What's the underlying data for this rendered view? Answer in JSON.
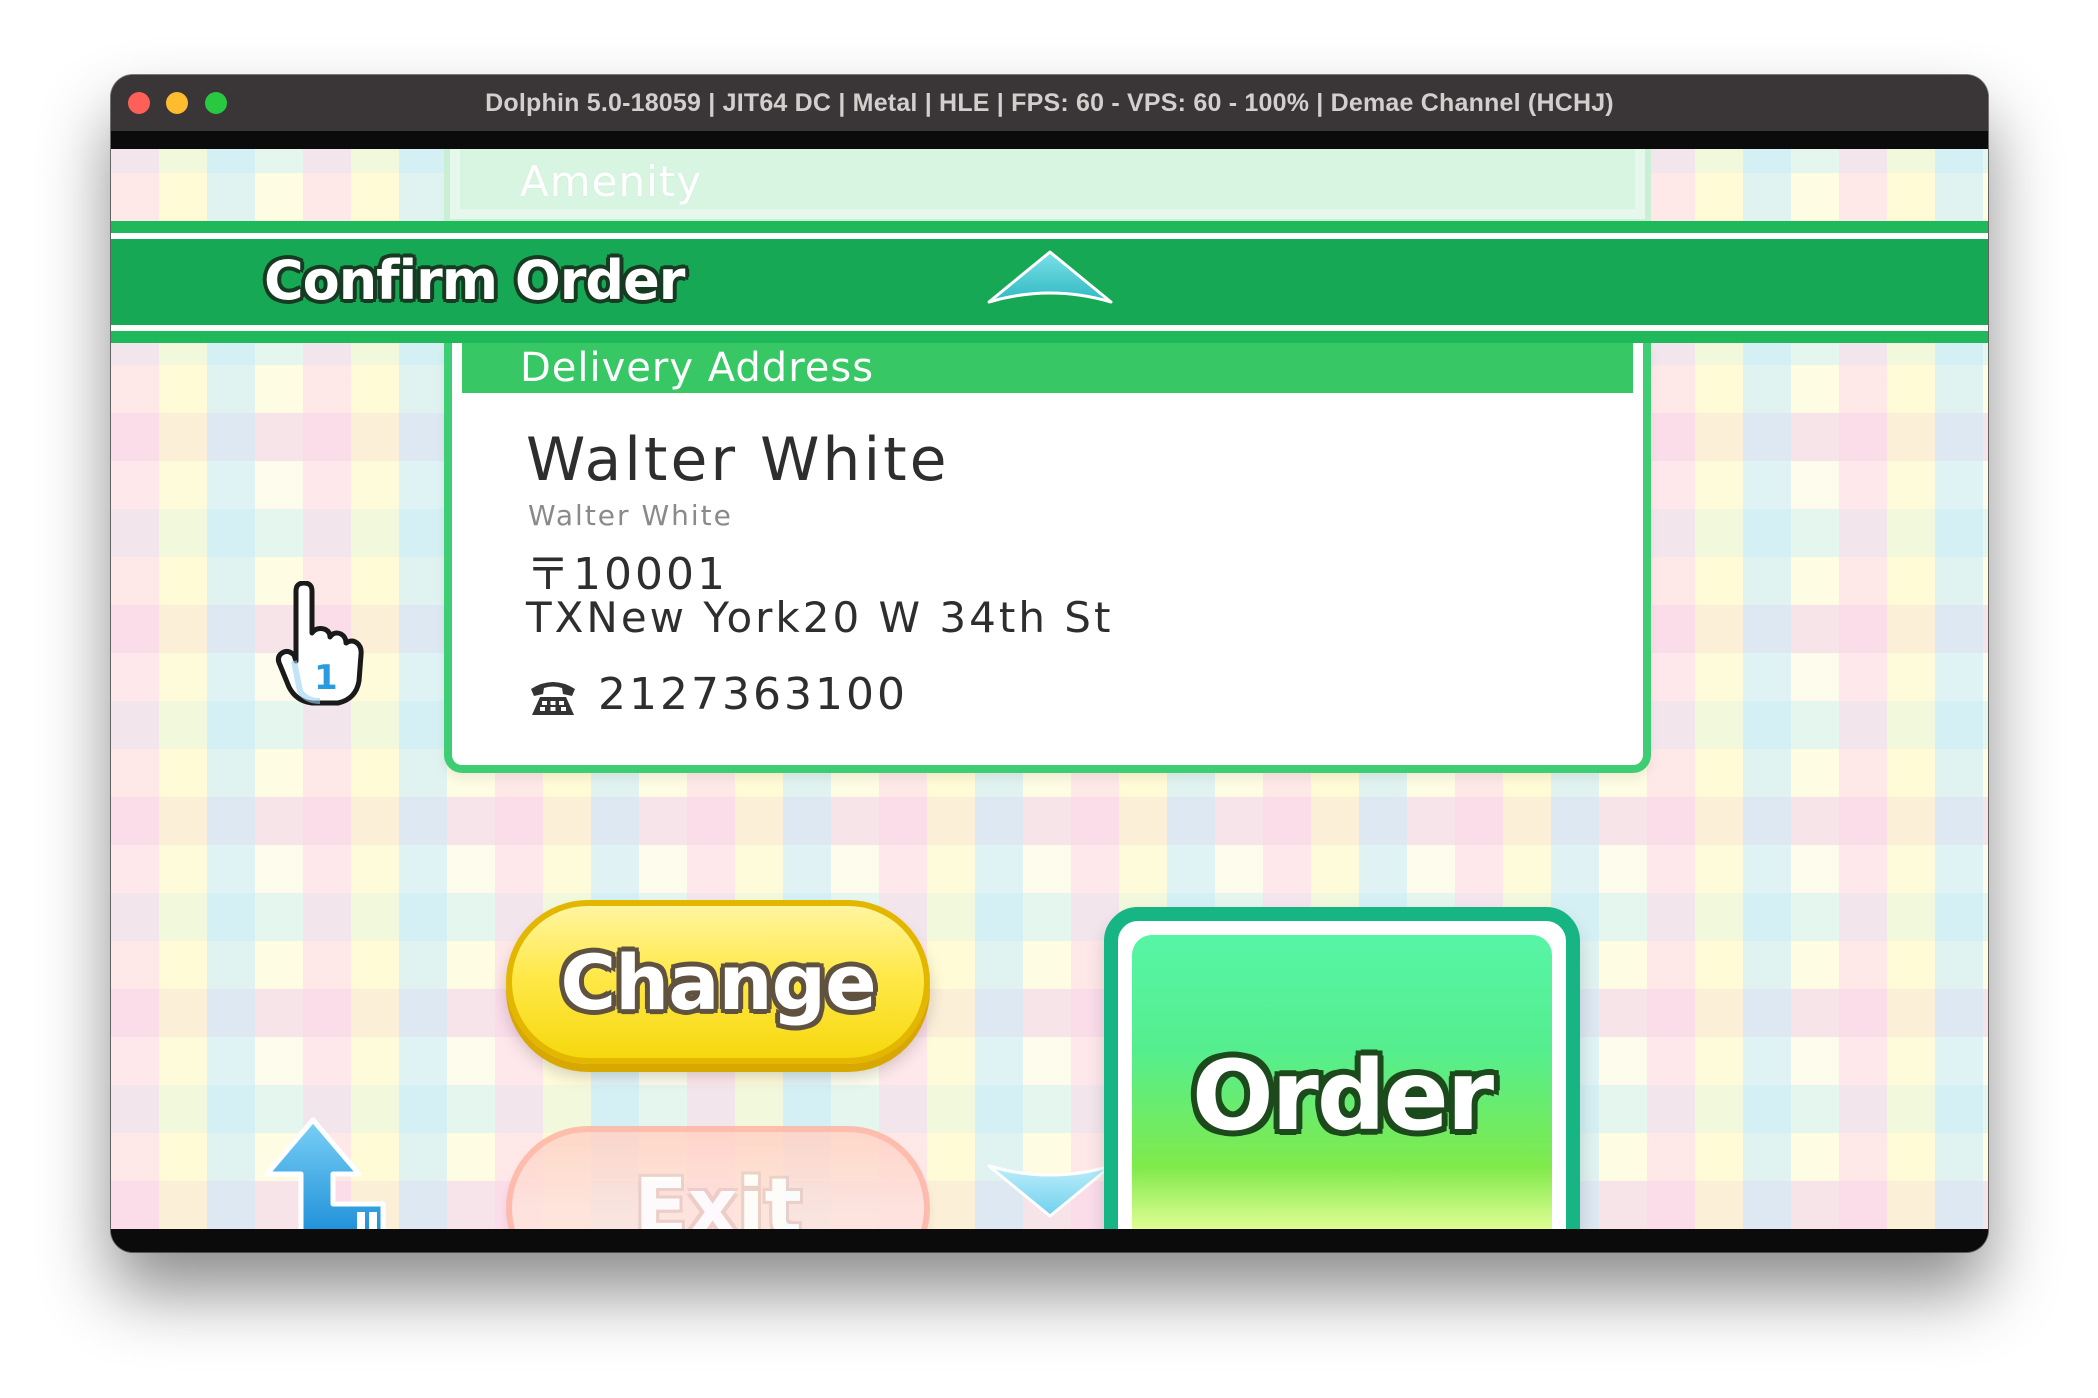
{
  "window": {
    "title": "Dolphin 5.0-18059 | JIT64 DC | Metal | HLE | FPS: 60 - VPS: 60 - 100% | Demae Channel (HCHJ)"
  },
  "header": {
    "previous_section": "Amenity",
    "title": "Confirm Order"
  },
  "delivery": {
    "section_label": "Delivery Address",
    "name": "Walter White",
    "name_reading": "Walter White",
    "postal_code": "〒10001",
    "address": "TXNew York20 W 34th St",
    "phone": "2127363100"
  },
  "actions": {
    "change_label": "Change",
    "exit_label": "Exit",
    "order_label": "Order"
  },
  "pointer": {
    "player_number": "1"
  },
  "colors": {
    "header_green": "#17a855",
    "card_border": "#3dcd72",
    "change_yellow": "#ffe94a",
    "exit_pink": "#ffd1c5",
    "order_green": "#16b583"
  }
}
